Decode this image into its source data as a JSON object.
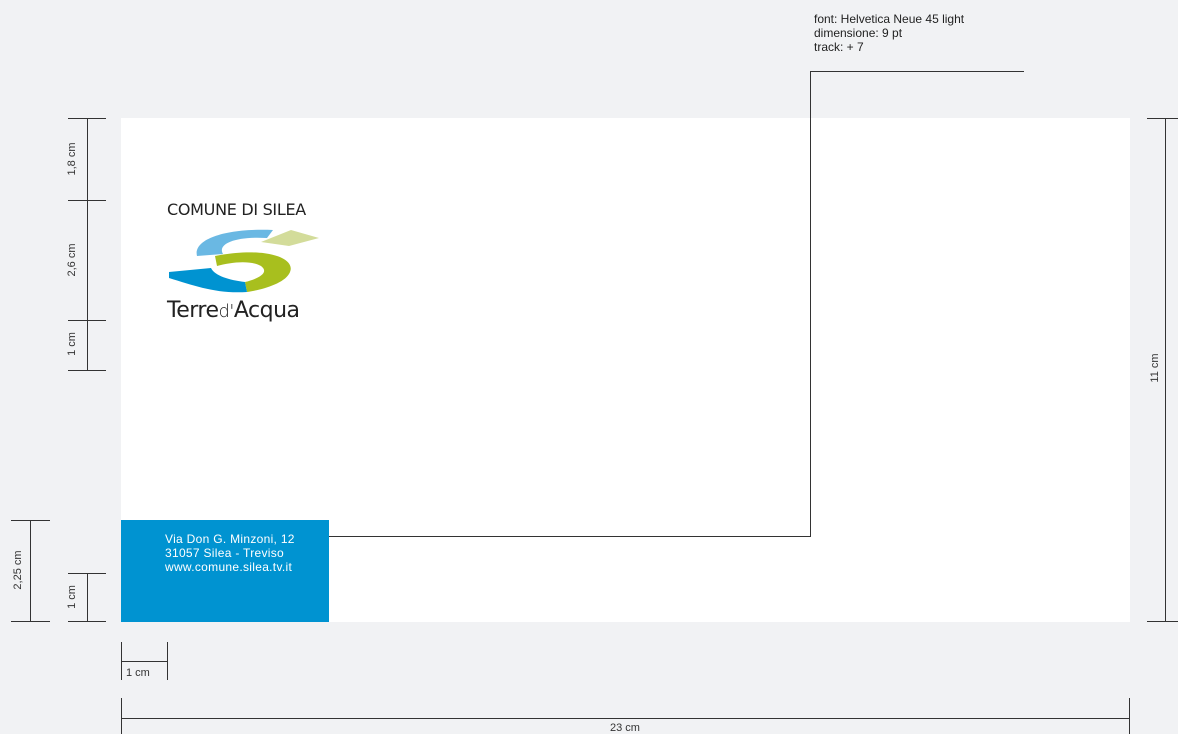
{
  "spec": {
    "font": "font: Helvetica Neue 45 light",
    "size": "dimensione: 9 pt",
    "track": "track: + 7"
  },
  "logo": {
    "top_text": "COMUNE DI SILEA",
    "bottom_text_bold": "Terre",
    "bottom_text_light": "d'",
    "bottom_text_end": "Acqua"
  },
  "footer": {
    "line1": "Via Don G. Minzoni, 12",
    "line2": "31057 Silea - Treviso",
    "line3": "www.comune.silea.tv.it"
  },
  "dimensions": {
    "top_margin": "1,8 cm",
    "logo_height": "2,6 cm",
    "logo_gap": "1 cm",
    "footer_height": "2,25 cm",
    "footer_bottom": "1 cm",
    "left_margin": "1 cm",
    "total_height": "11 cm",
    "total_width": "23 cm"
  },
  "colors": {
    "background": "#f1f2f4",
    "sheet": "#ffffff",
    "footer_blue": "#0093d1",
    "logo_light_blue": "#6ab8e3",
    "logo_dark_blue": "#0093d1",
    "logo_green": "#a8bf1e",
    "logo_pale_green": "#d3dc9a"
  }
}
